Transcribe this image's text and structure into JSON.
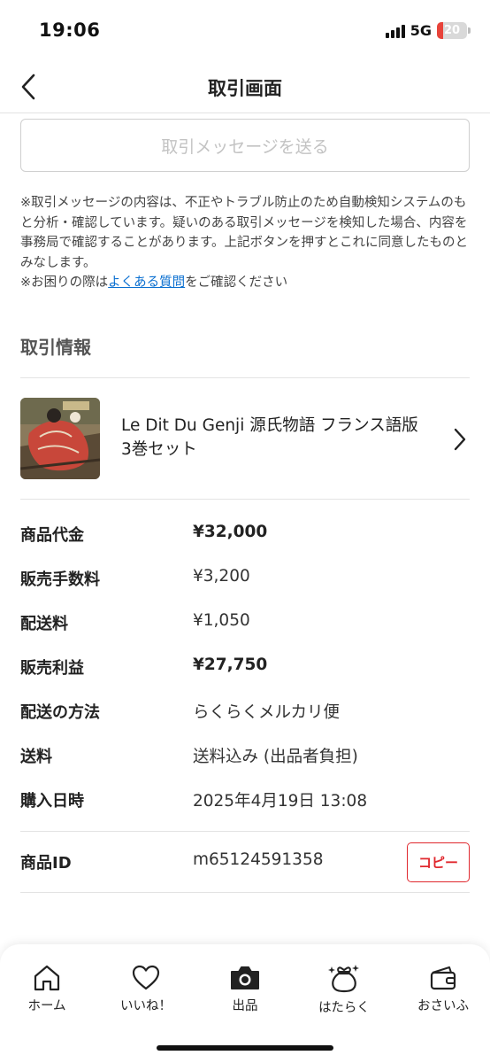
{
  "status_bar": {
    "time": "19:06",
    "network": "5G",
    "battery_level": "20",
    "battery_fraction": 0.2,
    "battery_color": "#e8433a"
  },
  "header": {
    "title": "取引画面",
    "back_icon": "chevron-left-icon"
  },
  "message_button": {
    "label": "取引メッセージを送る"
  },
  "notice": {
    "text1": "※取引メッセージの内容は、不正やトラブル防止のため自動検知システムのもと分析・確認しています。疑いのある取引メッセージを検知した場合、内容を事務局で確認することがあります。上記ボタンを押すとこれに同意したものとみなします。",
    "text2_prefix": "※お困りの際は",
    "link": "よくある質問",
    "text2_suffix": "をご確認ください"
  },
  "transaction": {
    "section_title": "取引情報",
    "product": {
      "name": "Le Dit Du Genji 源氏物語 フランス語版 3巻セット",
      "chevron_icon": "chevron-right-icon"
    },
    "details": [
      {
        "label": "商品代金",
        "value": "¥32,000"
      },
      {
        "label": "販売手数料",
        "value": "¥3,200"
      },
      {
        "label": "配送料",
        "value": "¥1,050"
      },
      {
        "label": "販売利益",
        "value": "¥27,750"
      },
      {
        "label": "配送の方法",
        "value": "らくらくメルカリ便"
      },
      {
        "label": "送料",
        "value": "送料込み (出品者負担)"
      },
      {
        "label": "購入日時",
        "value": "2025年4月19日 13:08"
      }
    ],
    "product_id": {
      "label": "商品ID",
      "value": "m65124591358",
      "copy_label": "コピー"
    }
  },
  "tab_bar": {
    "accent_color": "#e0282e",
    "tabs": [
      {
        "label": "ホーム",
        "icon": "home-icon"
      },
      {
        "label": "いいね！",
        "icon": "heart-icon"
      },
      {
        "label": "出品",
        "icon": "camera-icon"
      },
      {
        "label": "はたらく",
        "icon": "money-bag-icon"
      },
      {
        "label": "おさいふ",
        "icon": "wallet-icon"
      }
    ]
  }
}
